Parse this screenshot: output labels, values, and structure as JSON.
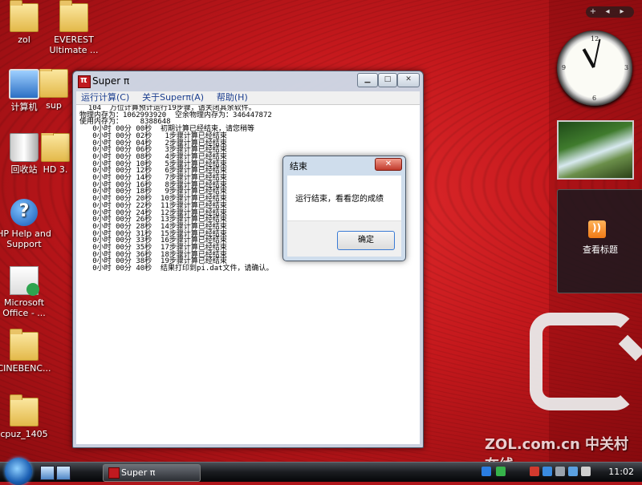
{
  "desktop_icons": [
    {
      "label": "zol",
      "type": "folder"
    },
    {
      "label": "EVEREST Ultimate ...",
      "type": "folder"
    },
    {
      "label": "计算机",
      "type": "computer"
    },
    {
      "label": "sup",
      "type": "folder"
    },
    {
      "label": "回收站",
      "type": "recycle-bin"
    },
    {
      "label": "HD 3.",
      "type": "folder"
    },
    {
      "label": "HP Help and Support",
      "type": "help"
    },
    {
      "label": "Microsoft Office - ...",
      "type": "office"
    },
    {
      "label": "CINEBENC...",
      "type": "folder"
    },
    {
      "label": "cpuz_1405",
      "type": "folder"
    }
  ],
  "superpi_window": {
    "title": "Super π",
    "controls": [
      "minimize",
      "maximize",
      "close"
    ],
    "menu": [
      "运行计算(C)",
      "关于Superπ(A)",
      "帮助(H)"
    ],
    "console_lines": [
      "  104  万位计算预计运行19步骤，请关闭其余软件。",
      "物理内存为：1062993920  空余物理内存为：346447872",
      "使用内存为：    8388648",
      "   0小时 00分 00秒  初期计算已经结束，请您稍等",
      "   0小时 00分 02秒   1步骤计算已经结束",
      "   0小时 00分 04秒   2步骤计算已经结束",
      "   0小时 00分 06秒   3步骤计算已经结束",
      "   0小时 00分 08秒   4步骤计算已经结束",
      "   0小时 00分 10秒   5步骤计算已经结束",
      "   0小时 00分 12秒   6步骤计算已经结束",
      "   0小时 00分 14秒   7步骤计算已经结束",
      "   0小时 00分 16秒   8步骤计算已经结束",
      "   0小时 00分 18秒   9步骤计算已经结束",
      "   0小时 00分 20秒  10步骤计算已经结束",
      "   0小时 00分 22秒  11步骤计算已经结束",
      "   0小时 00分 24秒  12步骤计算已经结束",
      "   0小时 00分 26秒  13步骤计算已经结束",
      "   0小时 00分 28秒  14步骤计算已经结束",
      "   0小时 00分 31秒  15步骤计算已经结束",
      "   0小时 00分 33秒  16步骤计算已经结束",
      "   0小时 00分 35秒  17步骤计算已经结束",
      "   0小时 00分 36秒  18步骤计算已经结束",
      "   0小时 00分 38秒  19步骤计算已经结束",
      "   0小时 00分 40秒  结果打印到pi.dat文件，请确认。"
    ]
  },
  "dialog": {
    "title": "结束",
    "message": "运行结束，看看您的成绩",
    "ok_label": "确定"
  },
  "sidebar": {
    "controls": [
      "+",
      "◂",
      "▸"
    ],
    "clock": {
      "hour": 11,
      "minute": 2
    },
    "rss_label": "查看标题"
  },
  "watermark": "ZOL.com.cn 中关村在线",
  "taskbar": {
    "task_label": "Super π",
    "time": "11:02"
  },
  "colors": {
    "desktop_red": "#c4181c",
    "window_frame": "#cddceb",
    "dialog_button_border": "#3a7bd5"
  }
}
